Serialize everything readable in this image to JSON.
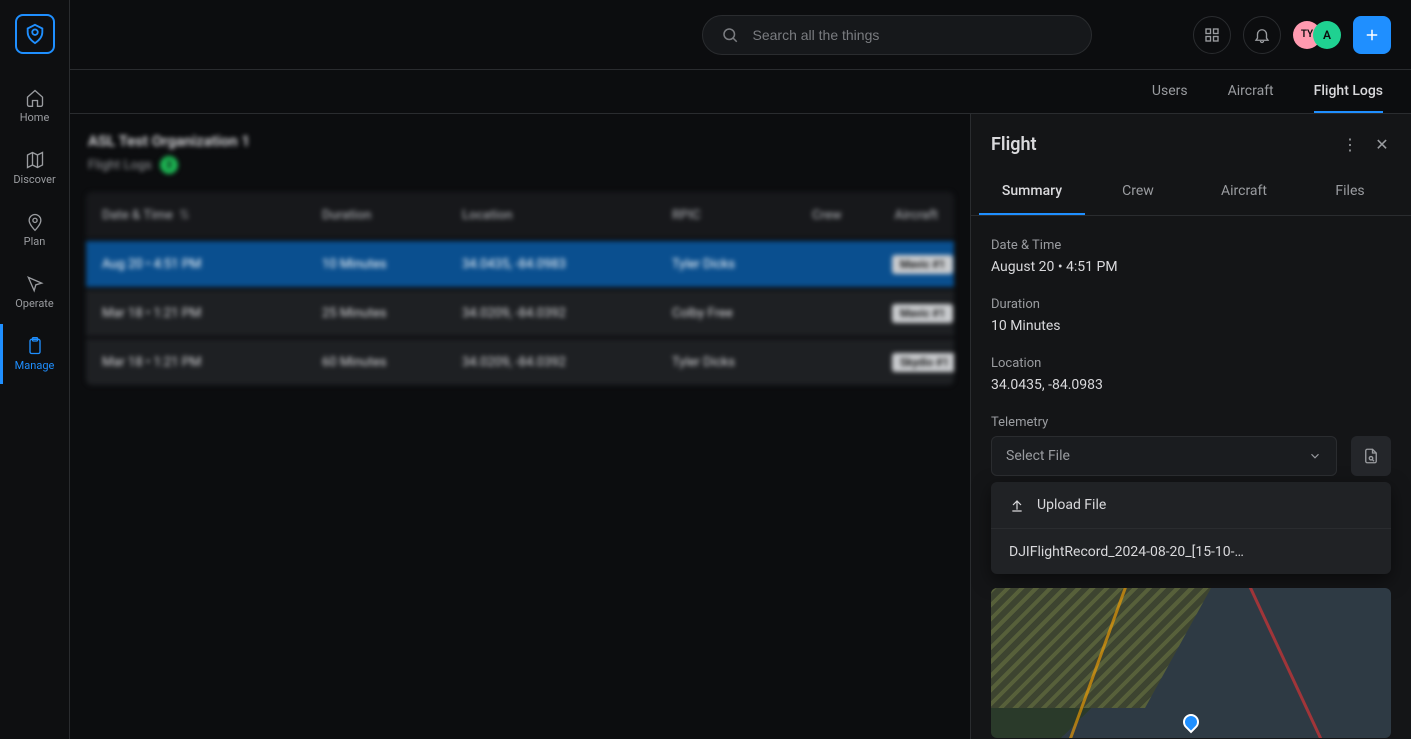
{
  "search": {
    "placeholder": "Search all the things"
  },
  "topbar": {
    "avatars": [
      {
        "id": "ty",
        "text": "TY"
      },
      {
        "id": "a",
        "text": "A"
      }
    ]
  },
  "sidenav": {
    "items": [
      {
        "key": "home",
        "label": "Home"
      },
      {
        "key": "discover",
        "label": "Discover"
      },
      {
        "key": "plan",
        "label": "Plan"
      },
      {
        "key": "operate",
        "label": "Operate"
      },
      {
        "key": "manage",
        "label": "Manage",
        "active": true
      }
    ]
  },
  "subtabs": [
    {
      "key": "users",
      "label": "Users"
    },
    {
      "key": "aircraft",
      "label": "Aircraft"
    },
    {
      "key": "flightlogs",
      "label": "Flight Logs",
      "active": true
    }
  ],
  "page": {
    "org_title": "ASL Test Organization 1",
    "crumb_label": "Flight Logs",
    "crumb_count": "3"
  },
  "table": {
    "columns": [
      "Date & Time",
      "Duration",
      "Location",
      "RPIC",
      "Crew",
      "Aircraft"
    ],
    "rows": [
      {
        "dt": "Aug 20 • 4:51 PM",
        "dur": "10 Minutes",
        "loc": "34.0435, -84.0983",
        "rpic": "Tyler Dicks",
        "crew": "",
        "ac": "Mavic #1",
        "selected": true
      },
      {
        "dt": "Mar 18 • 1:21 PM",
        "dur": "25 Minutes",
        "loc": "34.0209, -84.0392",
        "rpic": "Colby Free",
        "crew": "",
        "ac": "Mavic #1"
      },
      {
        "dt": "Mar 18 • 1:21 PM",
        "dur": "60 Minutes",
        "loc": "34.0209, -84.0392",
        "rpic": "Tyler Dicks",
        "crew": "",
        "ac": "Skydio #1"
      }
    ]
  },
  "detail": {
    "title": "Flight",
    "tabs": [
      {
        "key": "summary",
        "label": "Summary",
        "active": true
      },
      {
        "key": "crew",
        "label": "Crew"
      },
      {
        "key": "aircraft",
        "label": "Aircraft"
      },
      {
        "key": "files",
        "label": "Files"
      }
    ],
    "fields": {
      "datetime": {
        "label": "Date & Time",
        "value": "August 20 • 4:51 PM"
      },
      "duration": {
        "label": "Duration",
        "value": "10 Minutes"
      },
      "location": {
        "label": "Location",
        "value": "34.0435, -84.0983"
      },
      "telemetry": {
        "label": "Telemetry",
        "select_placeholder": "Select File"
      }
    },
    "dropdown": {
      "upload_label": "Upload File",
      "file_label": "DJIFlightRecord_2024-08-20_[15-10-…"
    }
  }
}
